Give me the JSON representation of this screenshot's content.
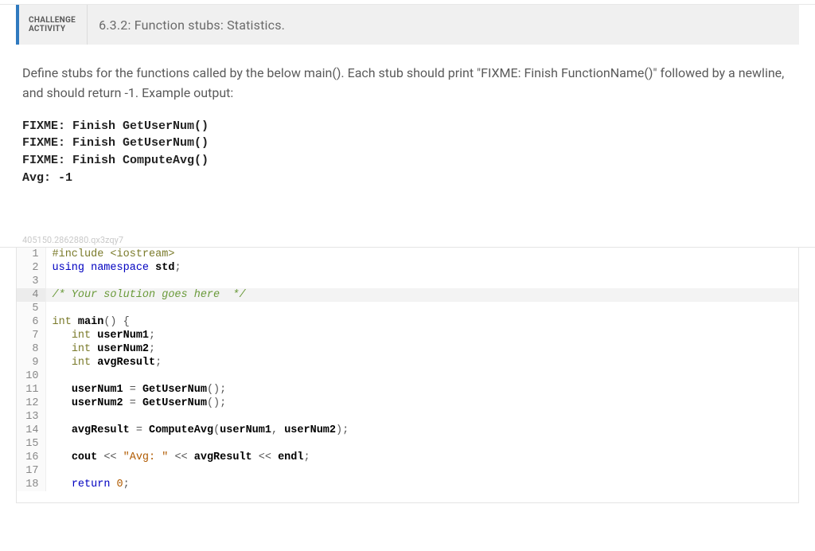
{
  "header": {
    "badge_line1": "CHALLENGE",
    "badge_line2": "ACTIVITY",
    "title": "6.3.2: Function stubs: Statistics."
  },
  "instructions": "Define stubs for the functions called by the below main(). Each stub should print \"FIXME: Finish FunctionName()\" followed by a newline, and should return -1. Example output:",
  "example_output": "FIXME: Finish GetUserNum()\nFIXME: Finish GetUserNum()\nFIXME: Finish ComputeAvg()\nAvg: -1",
  "hash": "405150.2862880.qx3zqy7",
  "code": {
    "highlight_line": 4,
    "lines": [
      {
        "n": 1,
        "tokens": [
          [
            "pp",
            "#include "
          ],
          [
            "pp",
            "<iostream>"
          ]
        ]
      },
      {
        "n": 2,
        "tokens": [
          [
            "kw",
            "using "
          ],
          [
            "kw",
            "namespace "
          ],
          [
            "id",
            "std"
          ],
          [
            "punc",
            ";"
          ]
        ]
      },
      {
        "n": 3,
        "tokens": []
      },
      {
        "n": 4,
        "tokens": [
          [
            "cm",
            "/* Your solution goes here  */"
          ]
        ]
      },
      {
        "n": 5,
        "tokens": []
      },
      {
        "n": 6,
        "tokens": [
          [
            "ty",
            "int "
          ],
          [
            "id",
            "main"
          ],
          [
            "punc",
            "() {"
          ]
        ]
      },
      {
        "n": 7,
        "tokens": [
          [
            "",
            "   "
          ],
          [
            "ty",
            "int "
          ],
          [
            "id",
            "userNum1"
          ],
          [
            "punc",
            ";"
          ]
        ]
      },
      {
        "n": 8,
        "tokens": [
          [
            "",
            "   "
          ],
          [
            "ty",
            "int "
          ],
          [
            "id",
            "userNum2"
          ],
          [
            "punc",
            ";"
          ]
        ]
      },
      {
        "n": 9,
        "tokens": [
          [
            "",
            "   "
          ],
          [
            "ty",
            "int "
          ],
          [
            "id",
            "avgResult"
          ],
          [
            "punc",
            ";"
          ]
        ]
      },
      {
        "n": 10,
        "tokens": []
      },
      {
        "n": 11,
        "tokens": [
          [
            "",
            "   "
          ],
          [
            "id",
            "userNum1"
          ],
          [
            "op",
            " = "
          ],
          [
            "id",
            "GetUserNum"
          ],
          [
            "punc",
            "();"
          ]
        ]
      },
      {
        "n": 12,
        "tokens": [
          [
            "",
            "   "
          ],
          [
            "id",
            "userNum2"
          ],
          [
            "op",
            " = "
          ],
          [
            "id",
            "GetUserNum"
          ],
          [
            "punc",
            "();"
          ]
        ]
      },
      {
        "n": 13,
        "tokens": []
      },
      {
        "n": 14,
        "tokens": [
          [
            "",
            "   "
          ],
          [
            "id",
            "avgResult"
          ],
          [
            "op",
            " = "
          ],
          [
            "id",
            "ComputeAvg"
          ],
          [
            "punc",
            "("
          ],
          [
            "id",
            "userNum1"
          ],
          [
            "punc",
            ", "
          ],
          [
            "id",
            "userNum2"
          ],
          [
            "punc",
            ");"
          ]
        ]
      },
      {
        "n": 15,
        "tokens": []
      },
      {
        "n": 16,
        "tokens": [
          [
            "",
            "   "
          ],
          [
            "id",
            "cout"
          ],
          [
            "op",
            " << "
          ],
          [
            "str",
            "\"Avg: \""
          ],
          [
            "op",
            " << "
          ],
          [
            "id",
            "avgResult"
          ],
          [
            "op",
            " << "
          ],
          [
            "id",
            "endl"
          ],
          [
            "punc",
            ";"
          ]
        ]
      },
      {
        "n": 17,
        "tokens": []
      },
      {
        "n": 18,
        "tokens": [
          [
            "",
            "   "
          ],
          [
            "kw",
            "return "
          ],
          [
            "num",
            "0"
          ],
          [
            "punc",
            ";"
          ]
        ]
      }
    ]
  }
}
